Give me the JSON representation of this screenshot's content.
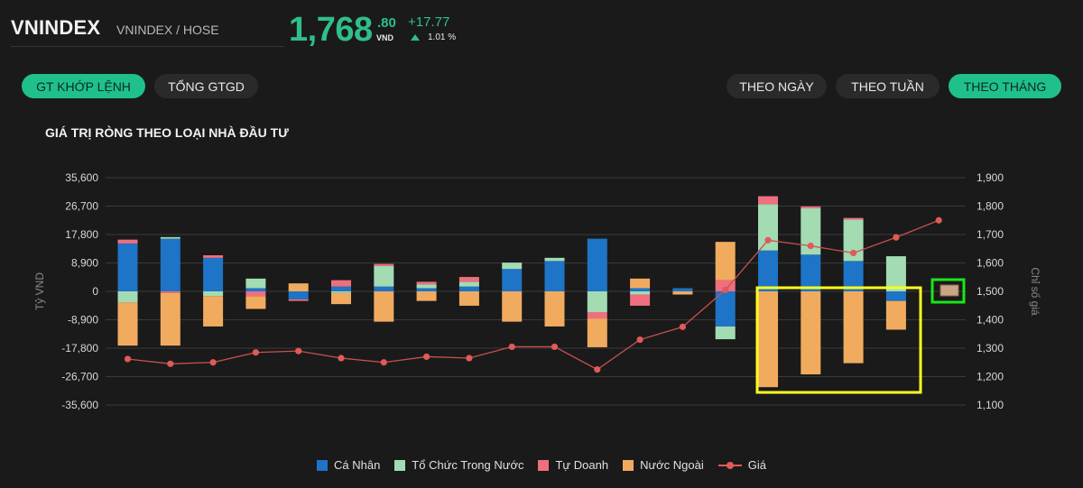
{
  "header": {
    "ticker": "VNINDEX",
    "exchange": "VNINDEX / HOSE",
    "price_int": "1,768",
    "price_dec": ".80",
    "currency": "VND",
    "change": "+17.77",
    "change_pct": "1.01 %",
    "up_color": "#2fbf8a"
  },
  "toggles": {
    "left": [
      {
        "label": "GT KHỚP LỆNH",
        "active": true
      },
      {
        "label": "TỔNG GTGD",
        "active": false
      }
    ],
    "right": [
      {
        "label": "THEO NGÀY",
        "active": false
      },
      {
        "label": "THEO TUẦN",
        "active": false
      },
      {
        "label": "THEO THÁNG",
        "active": true
      }
    ]
  },
  "chart_title": "GIÁ TRỊ RÒNG THEO LOẠI NHÀ ĐẦU TƯ",
  "chart_data": {
    "type": "bar",
    "stacked": true,
    "ylabel": "Tỷ VND",
    "y2label": "Chỉ số giá",
    "ylim": [
      -35600,
      35600
    ],
    "yticks": [
      "35,600",
      "26,700",
      "17,800",
      "8,900",
      "0",
      "-8,900",
      "-17,800",
      "-26,700",
      "-35,600"
    ],
    "y2lim": [
      1100,
      1900
    ],
    "y2ticks": [
      "1,900",
      "1,800",
      "1,700",
      "1,600",
      "1,500",
      "1,400",
      "1,300",
      "1,200",
      "1,100"
    ],
    "grid": true,
    "legend_position": "bottom",
    "series": [
      {
        "name": "Cá Nhân",
        "color": "#1e74c6",
        "values": [
          15000,
          16500,
          10500,
          1000,
          -2500,
          1500,
          1500,
          1000,
          1500,
          7000,
          9500,
          16500,
          1000,
          1000,
          -11000,
          12800,
          11500,
          9500,
          -3000,
          0
        ]
      },
      {
        "name": "Tổ Chức Trong Nước",
        "color": "#a3dbb3",
        "values": [
          -3500,
          500,
          -1500,
          3000,
          0,
          -500,
          6500,
          1200,
          1500,
          2000,
          1000,
          -6500,
          -1000,
          0,
          -4000,
          14500,
          14500,
          13000,
          11000,
          0
        ]
      },
      {
        "name": "Tự Doanh",
        "color": "#ef6f7f",
        "values": [
          1200,
          -500,
          800,
          -1500,
          -500,
          2000,
          600,
          800,
          1500,
          0,
          0,
          -2000,
          -3500,
          0,
          3500,
          2500,
          600,
          500,
          0,
          0
        ]
      },
      {
        "name": "Nước Ngoài",
        "color": "#f1ab5f",
        "values": [
          -13500,
          -16500,
          -9500,
          -4000,
          2500,
          -3500,
          -9500,
          -3000,
          -4500,
          -9500,
          -11000,
          -9000,
          3000,
          -1000,
          12000,
          -30000,
          -26000,
          -22500,
          -9000,
          0
        ]
      }
    ],
    "line_series": {
      "name": "Giá",
      "color": "#e05a5a",
      "values": [
        1262,
        1245,
        1250,
        1285,
        1290,
        1265,
        1250,
        1270,
        1265,
        1305,
        1305,
        1225,
        1330,
        1375,
        1505,
        1680,
        1660,
        1635,
        1690,
        1750
      ]
    }
  },
  "highlight_colors": {
    "yellow": "#ffff1f",
    "green": "#19e619"
  }
}
